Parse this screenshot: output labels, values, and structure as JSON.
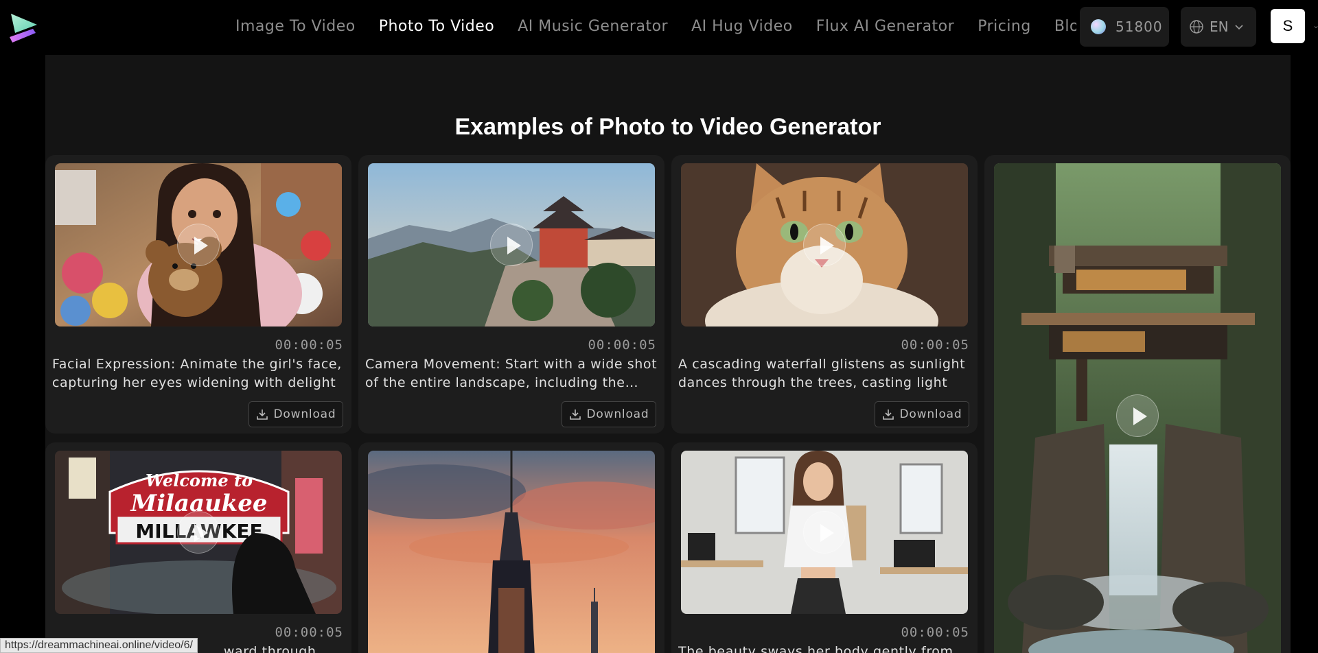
{
  "nav": {
    "links": [
      {
        "label": "Image To Video",
        "active": false
      },
      {
        "label": "Photo To Video",
        "active": true
      },
      {
        "label": "AI Music Generator",
        "active": false
      },
      {
        "label": "AI Hug Video",
        "active": false
      },
      {
        "label": "Flux AI Generator",
        "active": false
      },
      {
        "label": "Pricing",
        "active": false
      },
      {
        "label": "Blog",
        "active": false
      }
    ],
    "credits": "51800",
    "language": "EN",
    "avatar_letter": "S"
  },
  "main": {
    "title": "Examples of Photo to Video Generator",
    "download_label": "Download",
    "cards": [
      {
        "duration": "00:00:05",
        "description": "Facial Expression: Animate the girl's face, capturing her eyes widening with delight"
      },
      {
        "duration": "00:00:05",
        "description": "Camera Movement: Start with a wide shot of the entire landscape, including the temple"
      },
      {
        "duration": "00:00:05",
        "description": "A cascading waterfall glistens as sunlight dances through the trees, casting light"
      },
      {
        "duration": "00:00:05",
        "description": "...ward through"
      },
      {
        "duration": "00:00:05",
        "description": "The beauty sways her body gently from side to side"
      }
    ],
    "sign_text_line1": "Welcome to",
    "sign_text_line2": "Milaaukee",
    "sign_text_line3": "MILLAWKEE"
  },
  "status_url": "https://dreammachineai.online/video/6/",
  "colors": {
    "background": "#000000",
    "panel": "#141414",
    "card": "#1d1d1d",
    "nav_inactive": "#8d8d8d"
  }
}
